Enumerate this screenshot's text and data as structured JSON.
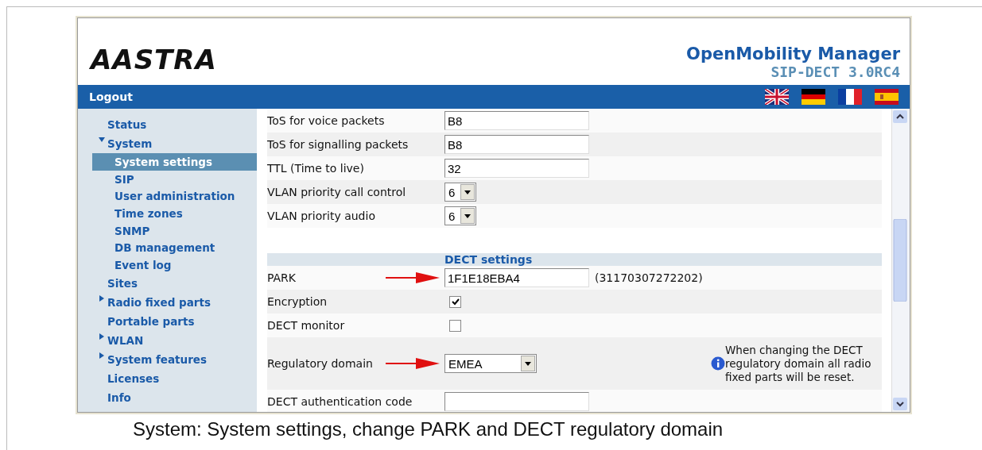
{
  "header": {
    "logo": "AASTRA",
    "product": "OpenMobility Manager",
    "version": "SIP-DECT 3.0RC4"
  },
  "menu_bar": {
    "logout": "Logout"
  },
  "sidebar": {
    "items": [
      {
        "label": "Status",
        "selected": false
      },
      {
        "label": "System",
        "selected": false,
        "expanded": true,
        "children": [
          {
            "label": "System settings",
            "selected": true
          },
          {
            "label": "SIP",
            "selected": false
          },
          {
            "label": "User administration",
            "selected": false
          },
          {
            "label": "Time zones",
            "selected": false
          },
          {
            "label": "SNMP",
            "selected": false
          },
          {
            "label": "DB management",
            "selected": false
          },
          {
            "label": "Event log",
            "selected": false
          }
        ]
      },
      {
        "label": "Sites",
        "selected": false
      },
      {
        "label": "Radio fixed parts",
        "selected": false,
        "expanded": false
      },
      {
        "label": "Portable parts",
        "selected": false
      },
      {
        "label": "WLAN",
        "selected": false,
        "expanded": false
      },
      {
        "label": "System features",
        "selected": false,
        "expanded": false
      },
      {
        "label": "Licenses",
        "selected": false
      },
      {
        "label": "Info",
        "selected": false
      }
    ]
  },
  "settings": [
    {
      "kind": "text",
      "label": "ToS for voice packets",
      "value": "B8",
      "arrow": false
    },
    {
      "kind": "text",
      "label": "ToS for signalling packets",
      "value": "B8",
      "arrow": false
    },
    {
      "kind": "text",
      "label": "TTL (Time to live)",
      "value": "32",
      "arrow": false
    },
    {
      "kind": "select",
      "label": "VLAN priority call control",
      "value": "6",
      "arrow": false
    },
    {
      "kind": "select",
      "label": "VLAN priority audio",
      "value": "6",
      "arrow": false
    },
    {
      "kind": "spacer"
    },
    {
      "kind": "section",
      "label": "DECT settings"
    },
    {
      "kind": "text",
      "label": "PARK",
      "value": "1F1E18EBA4",
      "note": "(31170307272202)",
      "arrow": true
    },
    {
      "kind": "checkbox",
      "label": "Encryption",
      "checked": true,
      "arrow": false
    },
    {
      "kind": "checkbox",
      "label": "DECT monitor",
      "checked": false,
      "arrow": false
    },
    {
      "kind": "wideselect",
      "label": "Regulatory domain",
      "value": "EMEA",
      "info": "When changing the DECT regulatory domain all radio fixed parts will be reset.",
      "arrow": true
    },
    {
      "kind": "text",
      "label": "DECT authentication code",
      "arrow": false
    }
  ],
  "caption": "System: System settings, change PARK and DECT regulatory domain"
}
